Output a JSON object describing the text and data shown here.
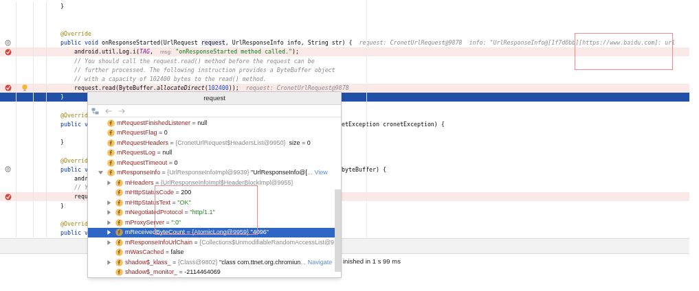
{
  "editor": {
    "lines": [
      {
        "kind": "code",
        "code": [
          {
            "t": "}",
            "kind": "plain"
          }
        ]
      },
      {
        "kind": "blank"
      },
      {
        "kind": "blank"
      },
      {
        "kind": "code",
        "code": [
          {
            "t": "@Override",
            "kind": "annotation"
          }
        ]
      },
      {
        "kind": "code",
        "override": true,
        "code": [
          {
            "t": "public void ",
            "kind": "keyword"
          },
          {
            "t": "onResponseStarted(UrlRequest ",
            "kind": "plain"
          },
          {
            "t": "request",
            "kind": "usage"
          },
          {
            "t": ", UrlResponseInfo info, String str) {",
            "kind": "plain"
          }
        ],
        "hint": "request: CronetUrlRequest@9878  info: \"UrlResponseInfo@[1f7d6bb][https://www.baidu.com]: url"
      },
      {
        "kind": "code",
        "breakpoint": true,
        "code": [
          {
            "t": "    android.util.Log.i(",
            "kind": "plain"
          },
          {
            "t": "TAG",
            "kind": "constant"
          },
          {
            "t": ",  ",
            "kind": "plain"
          },
          {
            "t": "msg:",
            "kind": "param"
          },
          {
            "t": " \"onResponseStarted method called.\"",
            "kind": "string"
          },
          {
            "t": ");",
            "kind": "plain"
          }
        ]
      },
      {
        "kind": "code",
        "code": [
          {
            "t": "    // You should call the request.read() method before the request can be",
            "kind": "comment"
          }
        ]
      },
      {
        "kind": "code",
        "code": [
          {
            "t": "    // further processed. The following instruction provides a ByteBuffer object",
            "kind": "comment"
          }
        ]
      },
      {
        "kind": "code",
        "code": [
          {
            "t": "    // with a capacity of 102400 bytes to the read() method.",
            "kind": "comment"
          }
        ]
      },
      {
        "kind": "code",
        "breakpoint": true,
        "bulb": true,
        "code": [
          {
            "t": "    request.read(ByteBuffer.",
            "kind": "plain"
          },
          {
            "t": "allocateDirect",
            "kind": "static"
          },
          {
            "t": "(",
            "kind": "plain"
          },
          {
            "t": "102400",
            "kind": "number"
          },
          {
            "t": "));",
            "kind": "plain"
          }
        ],
        "hint": "request: CronetUrlRequest@9878"
      },
      {
        "kind": "code",
        "current": true,
        "code": [
          {
            "t": "}",
            "kind": "plain"
          }
        ]
      },
      {
        "kind": "blank"
      },
      {
        "kind": "code",
        "code": [
          {
            "t": "@Overrid",
            "kind": "annotation"
          }
        ]
      },
      {
        "kind": "code",
        "code": [
          {
            "t": "public v",
            "kind": "keyword"
          }
        ],
        "right": [
          {
            "t": "etException cronetException) {",
            "kind": "plain"
          }
        ]
      },
      {
        "kind": "blank"
      },
      {
        "kind": "code",
        "code": [
          {
            "t": "}",
            "kind": "plain"
          }
        ]
      },
      {
        "kind": "blank"
      },
      {
        "kind": "code",
        "code": [
          {
            "t": "@Overrid",
            "kind": "annotation"
          }
        ]
      },
      {
        "kind": "code",
        "override": true,
        "code": [
          {
            "t": "public v",
            "kind": "keyword"
          }
        ],
        "right": [
          {
            "t": "byteBuffer) {",
            "kind": "plain"
          }
        ]
      },
      {
        "kind": "code",
        "code": [
          {
            "t": "    andr",
            "kind": "plain"
          }
        ]
      },
      {
        "kind": "code",
        "code": [
          {
            "t": "    // Y",
            "kind": "comment"
          }
        ]
      },
      {
        "kind": "code",
        "breakpoint": true,
        "code": [
          {
            "t": "    requ",
            "kind": "plain"
          }
        ]
      },
      {
        "kind": "code",
        "code": [
          {
            "t": "}",
            "kind": "plain"
          }
        ]
      },
      {
        "kind": "blank"
      },
      {
        "kind": "code",
        "code": [
          {
            "t": "@Overrid",
            "kind": "annotation"
          }
        ]
      },
      {
        "kind": "code",
        "code": [
          {
            "t": "public v",
            "kind": "keyword"
          }
        ]
      }
    ]
  },
  "popup": {
    "title": "request",
    "items": [
      {
        "name": "mRequestFinishedListener",
        "parts": [
          {
            "t": " = null",
            "kind": "plain"
          }
        ],
        "selected": false
      },
      {
        "name": "mRequestFlag",
        "parts": [
          {
            "t": " = 0",
            "kind": "plain"
          }
        ],
        "selected": false
      },
      {
        "name": "mRequestHeaders",
        "parts": [
          {
            "t": " = ",
            "kind": "plain"
          },
          {
            "t": "{CronetUrlRequest$HeadersList@9950}",
            "kind": "ref"
          },
          {
            "t": "  size = 0",
            "kind": "plain"
          }
        ],
        "selected": false
      },
      {
        "name": "mRequestLog",
        "parts": [
          {
            "t": " = null",
            "kind": "plain"
          }
        ],
        "selected": false
      },
      {
        "name": "mRequestTimeout",
        "parts": [
          {
            "t": " = 0",
            "kind": "plain"
          }
        ],
        "selected": false
      },
      {
        "name": "mResponseInfo",
        "parts": [
          {
            "t": " = ",
            "kind": "plain"
          },
          {
            "t": "{UrlResponseInfoImpl@9939}",
            "kind": "ref"
          },
          {
            "t": " \"UrlResponseInfo@[",
            "kind": "plain"
          },
          {
            "t": "...",
            "kind": "ref"
          }
        ],
        "link": "View",
        "expanded": true,
        "selected": false,
        "children": [
          {
            "name": "mHeaders",
            "parts": [
              {
                "t": " = ",
                "kind": "plain"
              },
              {
                "t": "{UrlResponseInfoImpl$HeaderBlockImpl@9955}",
                "kind": "ref"
              }
            ],
            "expanded": false,
            "selected": false
          },
          {
            "name": "mHttpStatusCode",
            "parts": [
              {
                "t": " = 200",
                "kind": "plain"
              }
            ],
            "selected": false
          },
          {
            "name": "mHttpStatusText",
            "parts": [
              {
                "t": " = ",
                "kind": "plain"
              },
              {
                "t": "\"OK\"",
                "kind": "string"
              }
            ],
            "expanded": false,
            "selected": false
          },
          {
            "name": "mNegotiatedProtocol",
            "parts": [
              {
                "t": " = ",
                "kind": "plain"
              },
              {
                "t": "\"http/1.1\"",
                "kind": "string"
              }
            ],
            "expanded": false,
            "selected": false
          },
          {
            "name": "mProxyServer",
            "parts": [
              {
                "t": " = ",
                "kind": "plain"
              },
              {
                "t": "\":0\"",
                "kind": "string"
              }
            ],
            "expanded": false,
            "selected": false
          },
          {
            "name": "mReceivedByteCount",
            "parts": [
              {
                "t": " = ",
                "kind": "plain"
              },
              {
                "t": "{AtomicLong@9959}",
                "kind": "ref"
              },
              {
                "t": " \"4096\"",
                "kind": "plain"
              }
            ],
            "expanded": false,
            "selected": true
          },
          {
            "name": "mResponseInfoUrlChain",
            "parts": [
              {
                "t": " = ",
                "kind": "plain"
              },
              {
                "t": "{Collections$UnmodifiableRandomAccessList@9",
                "kind": "ref"
              }
            ],
            "expanded": false,
            "selected": false
          },
          {
            "name": "mWasCached",
            "parts": [
              {
                "t": " = false",
                "kind": "plain"
              }
            ],
            "selected": false
          },
          {
            "name": "shadow$_klass_",
            "parts": [
              {
                "t": " = ",
                "kind": "plain"
              },
              {
                "t": "{Class@9802}",
                "kind": "ref"
              },
              {
                "t": " \"class com.ttnet.org.chromiun",
                "kind": "plain"
              },
              {
                "t": "...",
                "kind": "ref"
              }
            ],
            "link": "Navigate",
            "expanded": false,
            "selected": false
          },
          {
            "name": "shadow$_monitor_",
            "parts": [
              {
                "t": " = -2114464069",
                "kind": "plain"
              }
            ],
            "selected": false
          }
        ]
      }
    ]
  },
  "status": {
    "message": "inished in 1 s 99 ms"
  }
}
